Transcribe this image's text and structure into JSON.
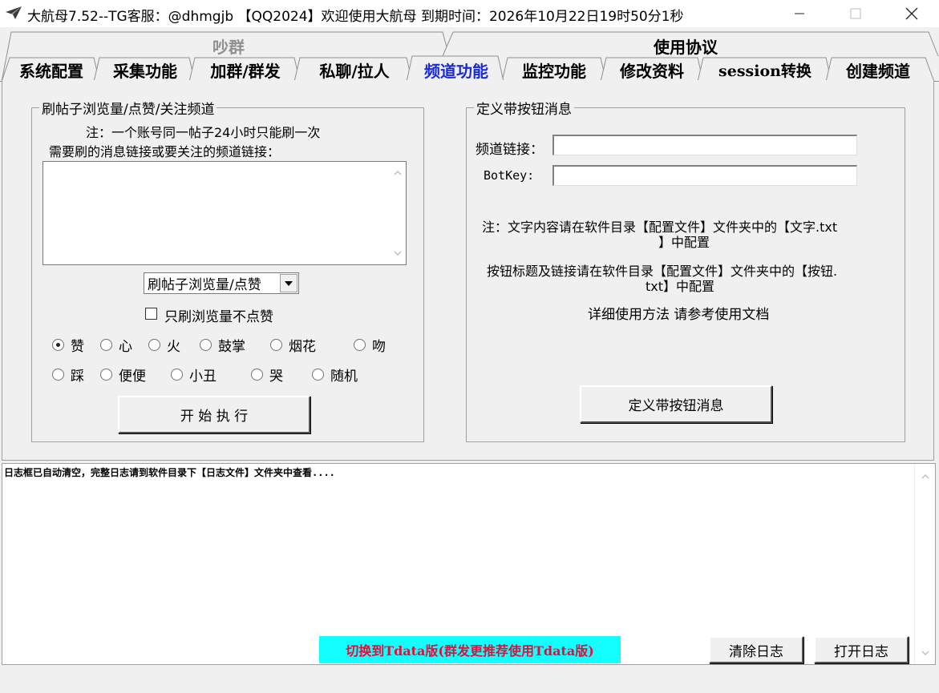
{
  "window": {
    "title": "大航母7.52--TG客服：@dhmgjb 【QQ2024】欢迎使用大航母 到期时间：2026年10月22日19时50分1秒"
  },
  "tabs_top": [
    {
      "label": "吵群"
    },
    {
      "label": "使用协议"
    }
  ],
  "tabs": [
    {
      "label": "系统配置"
    },
    {
      "label": "采集功能"
    },
    {
      "label": "加群/群发"
    },
    {
      "label": "私聊/拉人"
    },
    {
      "label": "频道功能"
    },
    {
      "label": "监控功能"
    },
    {
      "label": "修改资料"
    },
    {
      "label": "session转换"
    },
    {
      "label": "创建频道"
    }
  ],
  "left_group": {
    "title": "刷帖子浏览量/点赞/关注频道",
    "note": "注：一个账号同一帖子24小时只能刷一次",
    "link_label": "需要刷的消息链接或要关注的频道链接：",
    "link_value": "",
    "mode_select": "刷帖子浏览量/点赞",
    "only_views_label": "只刷浏览量不点赞",
    "reactions_row1": [
      {
        "label": "赞",
        "checked": true
      },
      {
        "label": "心",
        "checked": false
      },
      {
        "label": "火",
        "checked": false
      },
      {
        "label": "鼓掌",
        "checked": false
      },
      {
        "label": "烟花",
        "checked": false
      },
      {
        "label": "吻",
        "checked": false
      }
    ],
    "reactions_row2": [
      {
        "label": "踩",
        "checked": false
      },
      {
        "label": "便便",
        "checked": false
      },
      {
        "label": "小丑",
        "checked": false
      },
      {
        "label": "哭",
        "checked": false
      },
      {
        "label": "随机",
        "checked": false
      }
    ],
    "start_button": "开 始 执 行"
  },
  "right_group": {
    "title": "定义带按钮消息",
    "channel_label": "频道链接：",
    "channel_value": "",
    "botkey_label": "BotKey:",
    "botkey_value": "",
    "note1_line1": "注：文字内容请在软件目录【配置文件】文件夹中的【文字.txt",
    "note1_line2": "】中配置",
    "note2_line1": "按钮标题及链接请在软件目录【配置文件】文件夹中的【按钮.",
    "note2_line2": "txt】中配置",
    "note3": "详细使用方法 请参考使用文档",
    "define_button": "定义带按钮消息"
  },
  "log": {
    "text": "日志框已自动清空，完整日志请到软件目录下【日志文件】文件夹中查看....",
    "switch_tdata": "切换到Tdata版(群发更推荐使用Tdata版)",
    "clear_button": "清除日志",
    "open_button": "打开日志"
  },
  "colors": {
    "active_tab": "#1a2bd6",
    "tdata_bg": "#12ffff",
    "tdata_text": "#e0103a"
  }
}
